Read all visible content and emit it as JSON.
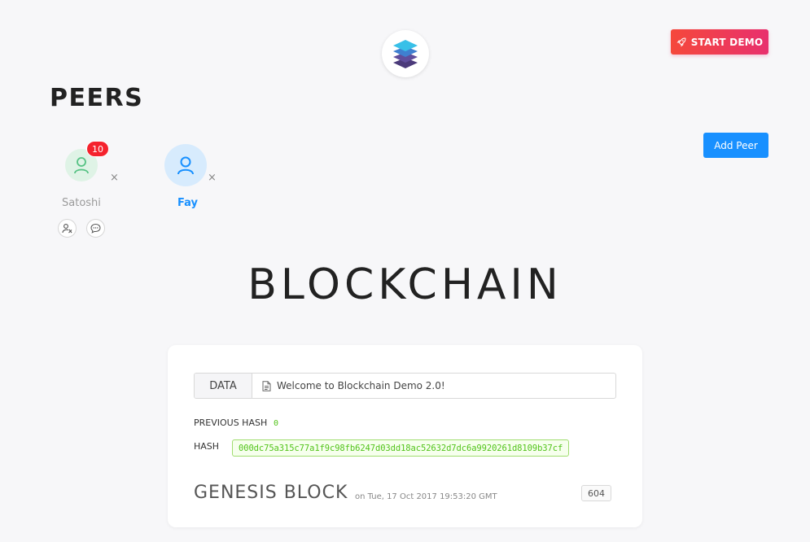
{
  "header": {
    "logo_icon": "layers-stack-icon",
    "start_demo_label": "START DEMO",
    "start_demo_icon": "rocket-icon"
  },
  "peers": {
    "title": "PEERS",
    "add_peer_label": "Add Peer",
    "list": [
      {
        "name": "Satoshi",
        "badge": "10",
        "active": false,
        "actions": [
          "mine-icon",
          "message-icon"
        ]
      },
      {
        "name": "Fay",
        "active": true
      }
    ],
    "remove_symbol": "×"
  },
  "blockchain": {
    "title": "BLOCKCHAIN",
    "block": {
      "data_label": "DATA",
      "data_value": "Welcome to Blockchain Demo 2.0!",
      "previous_hash_label": "PREVIOUS HASH",
      "previous_hash_value": "0",
      "hash_label": "HASH",
      "hash_value": "000dc75a315c77a1f9c98fb6247d03dd18ac52632d7dc6a9920261d8109b37cf",
      "name": "GENESIS BLOCK",
      "date": "on Tue, 17 Oct 2017 19:53:20 GMT",
      "nonce": "604"
    }
  },
  "colors": {
    "accent_blue": "#1890ff",
    "demo_gradient_start": "#f5483b",
    "demo_gradient_end": "#e8306e",
    "hash_green": "#52c41a",
    "badge_red": "#f5222d"
  }
}
